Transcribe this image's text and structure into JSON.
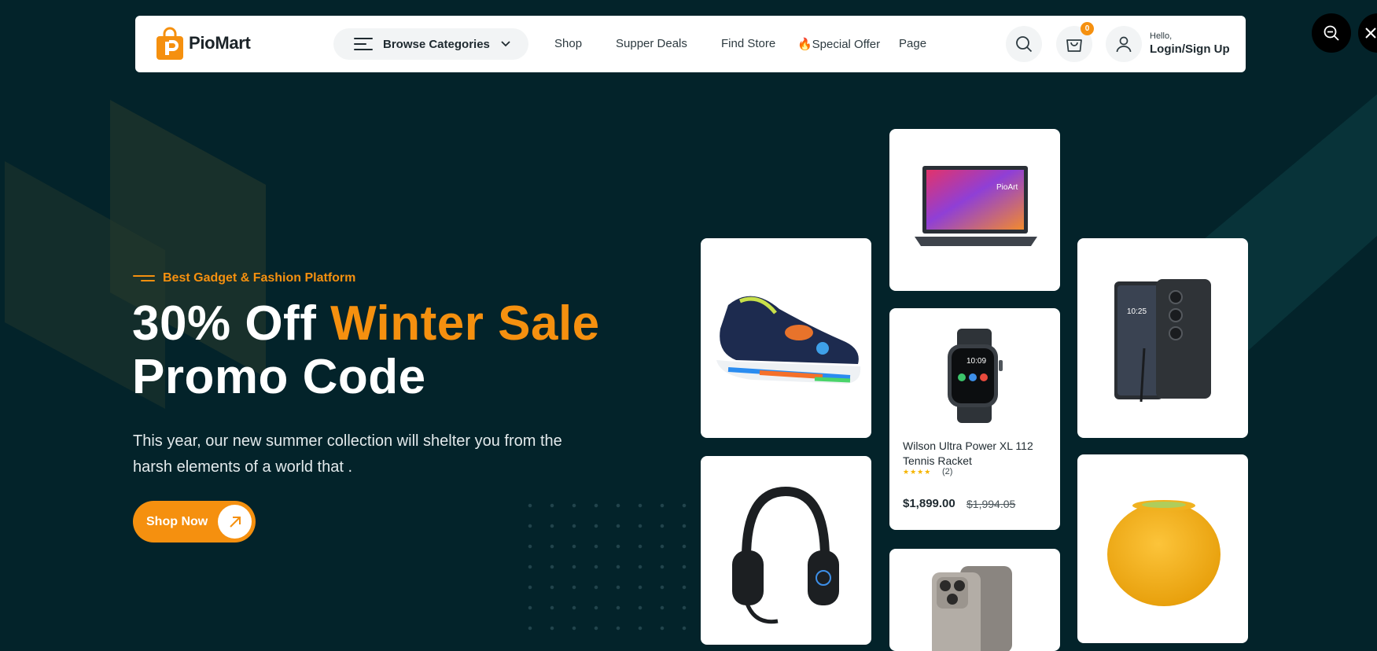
{
  "colors": {
    "background": "#03232a",
    "accent": "#f5900f",
    "header_bg": "#ffffff",
    "card_bg": "#ffffff"
  },
  "header": {
    "logo_text": "PioMart",
    "browse_label": "Browse Categories",
    "nav": [
      "Shop",
      "Supper Deals",
      "Find Store",
      "🔥Special Offer",
      "Page"
    ],
    "cart_count": "0",
    "greeting": "Hello,",
    "login_label": "Login/Sign Up",
    "icons": [
      "search-icon",
      "cart-icon",
      "user-icon",
      "chevron-down-icon",
      "menu-icon"
    ]
  },
  "overlay_controls": {
    "icons": [
      "zoom-out-icon",
      "close-icon"
    ]
  },
  "hero": {
    "tagline": "Best Gadget & Fashion Platform",
    "headline_prefix": "30% Off ",
    "headline_accent": "Winter Sale",
    "headline_line2": "Promo Code",
    "description": "This year, our new summer collection will shelter you from the harsh elements of a world that .",
    "cta_label": "Shop Now",
    "cta_icon": "arrow-up-right-icon"
  },
  "products": {
    "featured": {
      "name": "Wilson Ultra Power XL 112 Tennis Racket",
      "rating": 4,
      "rating_stars": "★★★★",
      "reviews": "(2)",
      "price": "$1,899.00",
      "old_price": "$1,994.05"
    },
    "laptop_screen_text": "PioArt",
    "watch_time": "10:09",
    "phone_time": "10:25",
    "cards": [
      "laptop",
      "sneaker",
      "smartwatch",
      "smartphone",
      "headphones",
      "iphone",
      "smart-speaker"
    ]
  }
}
